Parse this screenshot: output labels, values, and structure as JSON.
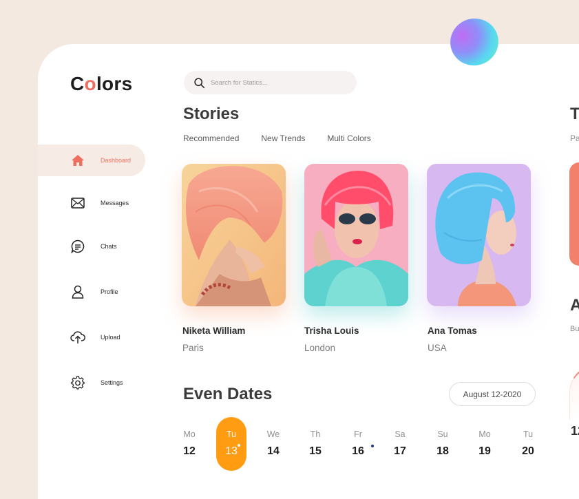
{
  "app": {
    "logo_prefix": "C",
    "logo_o": "o",
    "logo_suffix": "lors"
  },
  "search": {
    "placeholder": "Search for Statics..."
  },
  "sidebar": {
    "items": [
      {
        "label": "Dashboard",
        "icon": "home-icon",
        "active": true
      },
      {
        "label": "Messages",
        "icon": "mail-icon"
      },
      {
        "label": "Chats",
        "icon": "chat-icon"
      },
      {
        "label": "Profile",
        "icon": "user-icon"
      },
      {
        "label": "Upload",
        "icon": "cloud-upload-icon"
      },
      {
        "label": "Settings",
        "icon": "gear-icon"
      }
    ]
  },
  "stories": {
    "title": "Stories",
    "tabs": [
      "Recommended",
      "New Trends",
      "Multi Colors"
    ],
    "cards": [
      {
        "name": "Niketa William",
        "city": "Paris"
      },
      {
        "name": "Trisha Louis",
        "city": "London"
      },
      {
        "name": "Ana Tomas",
        "city": "USA"
      }
    ]
  },
  "right_column": {
    "title_partial": "T",
    "sub_partial": "Pa",
    "title2_partial": "A",
    "sub2_partial": "Bu",
    "number_partial": "12"
  },
  "dates": {
    "title": "Even Dates",
    "range": "August 12-2020",
    "days": [
      {
        "name": "Mo",
        "date": "12"
      },
      {
        "name": "Tu",
        "date": "13",
        "active": true
      },
      {
        "name": "We",
        "date": "14"
      },
      {
        "name": "Th",
        "date": "15"
      },
      {
        "name": "Fr",
        "date": "16"
      },
      {
        "name": "Sa",
        "date": "17"
      },
      {
        "name": "Su",
        "date": "18"
      },
      {
        "name": "Mo",
        "date": "19"
      },
      {
        "name": "Tu",
        "date": "20"
      }
    ]
  },
  "colors": {
    "accent": "#ef6f5f",
    "active_day": "#ff9c12",
    "background": "#f4e9e1"
  }
}
